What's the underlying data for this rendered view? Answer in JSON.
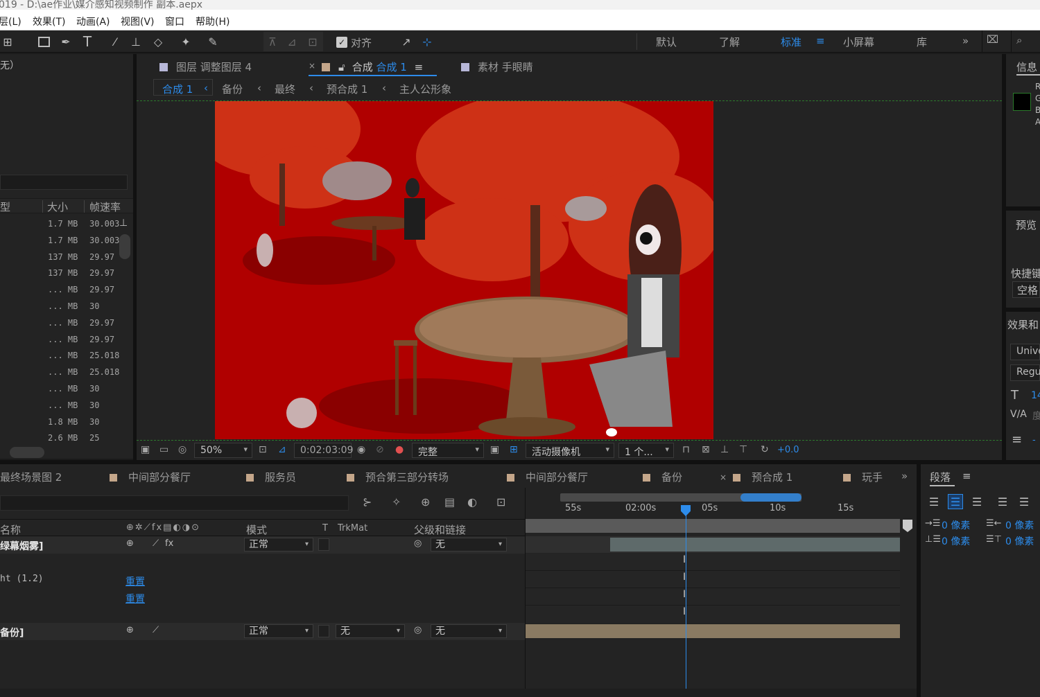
{
  "window": {
    "title": "019 - D:\\ae作业\\媒介感知视频制作 副本.aepx"
  },
  "menu": [
    "层(L)",
    "效果(T)",
    "动画(A)",
    "视图(V)",
    "窗口",
    "帮助(H)"
  ],
  "toolbar": {
    "align_label": "对齐"
  },
  "workspaces": [
    "默认",
    "了解",
    "标准",
    "小屏幕",
    "库"
  ],
  "project": {
    "top_text": "无）",
    "columns": {
      "type": "型",
      "size": "大小",
      "fps": "帧速率"
    },
    "rows": [
      {
        "size": "1.7 MB",
        "fps": "30.003"
      },
      {
        "size": "1.7 MB",
        "fps": "30.003"
      },
      {
        "size": "137 MB",
        "fps": "29.97"
      },
      {
        "size": "137 MB",
        "fps": "29.97"
      },
      {
        "size": "... MB",
        "fps": "29.97"
      },
      {
        "size": "... MB",
        "fps": "30"
      },
      {
        "size": "... MB",
        "fps": "29.97"
      },
      {
        "size": "... MB",
        "fps": "29.97"
      },
      {
        "size": "... MB",
        "fps": "25.018"
      },
      {
        "size": "... MB",
        "fps": "25.018"
      },
      {
        "size": "... MB",
        "fps": "30"
      },
      {
        "size": "... MB",
        "fps": "30"
      },
      {
        "size": "1.8 MB",
        "fps": "30"
      },
      {
        "size": "2.6 MB",
        "fps": "25"
      }
    ]
  },
  "viewer_tabs": {
    "layer": "图层 调整图层 4",
    "comp_prefix": "合成",
    "comp_name": "合成 1",
    "footage": "素材 手眼睛",
    "close": "×"
  },
  "breadcrumbs": [
    "合成 1",
    "备份",
    "最终",
    "预合成 1",
    "主人公形象"
  ],
  "viewer_footer": {
    "zoom": "50%",
    "timecode": "0:02:03:09",
    "quality": "完整",
    "camera": "活动摄像机",
    "views": "1 个...",
    "exposure": "+0.0"
  },
  "timeline_tabs": [
    "最终场景图 2",
    "中间部分餐厅",
    "服务员",
    "预合第三部分转场",
    "中间部分餐厅",
    "备份",
    "预合成 1",
    "玩手"
  ],
  "timeline_tab_close": "×",
  "columns": {
    "name": "名称",
    "mode": "模式",
    "t": "T",
    "trkmat": "TrkMat",
    "parent": "父级和链接"
  },
  "layers": [
    {
      "name": "绿幕烟雾]",
      "mode": "正常",
      "parent": "无"
    },
    {
      "name": "备份]",
      "mode": "正常",
      "trkmat": "无",
      "parent": "无"
    }
  ],
  "property": {
    "name": "ht (1.2)",
    "reset1": "重置",
    "reset2": "重置"
  },
  "ruler": [
    "55s",
    "02:00s",
    "05s",
    "10s",
    "15s"
  ],
  "right_panel": {
    "info": "信息",
    "rgba": [
      "R",
      "G",
      "B",
      "A"
    ],
    "preview": "预览",
    "shortcut": "快捷键",
    "space": "空格",
    "effects": "效果和",
    "font": "Unive",
    "style": "Regul",
    "font_size": "14",
    "tracking": "度"
  },
  "paragraph": {
    "title": "段落",
    "indent_left": "0 像素",
    "indent_right": "0 像素",
    "space_before": "0 像素",
    "space_after": "0 像素"
  },
  "colors": {
    "accent": "#2d8ceb",
    "comp_red": "#b00000",
    "tab_label": "#c4a68a"
  }
}
